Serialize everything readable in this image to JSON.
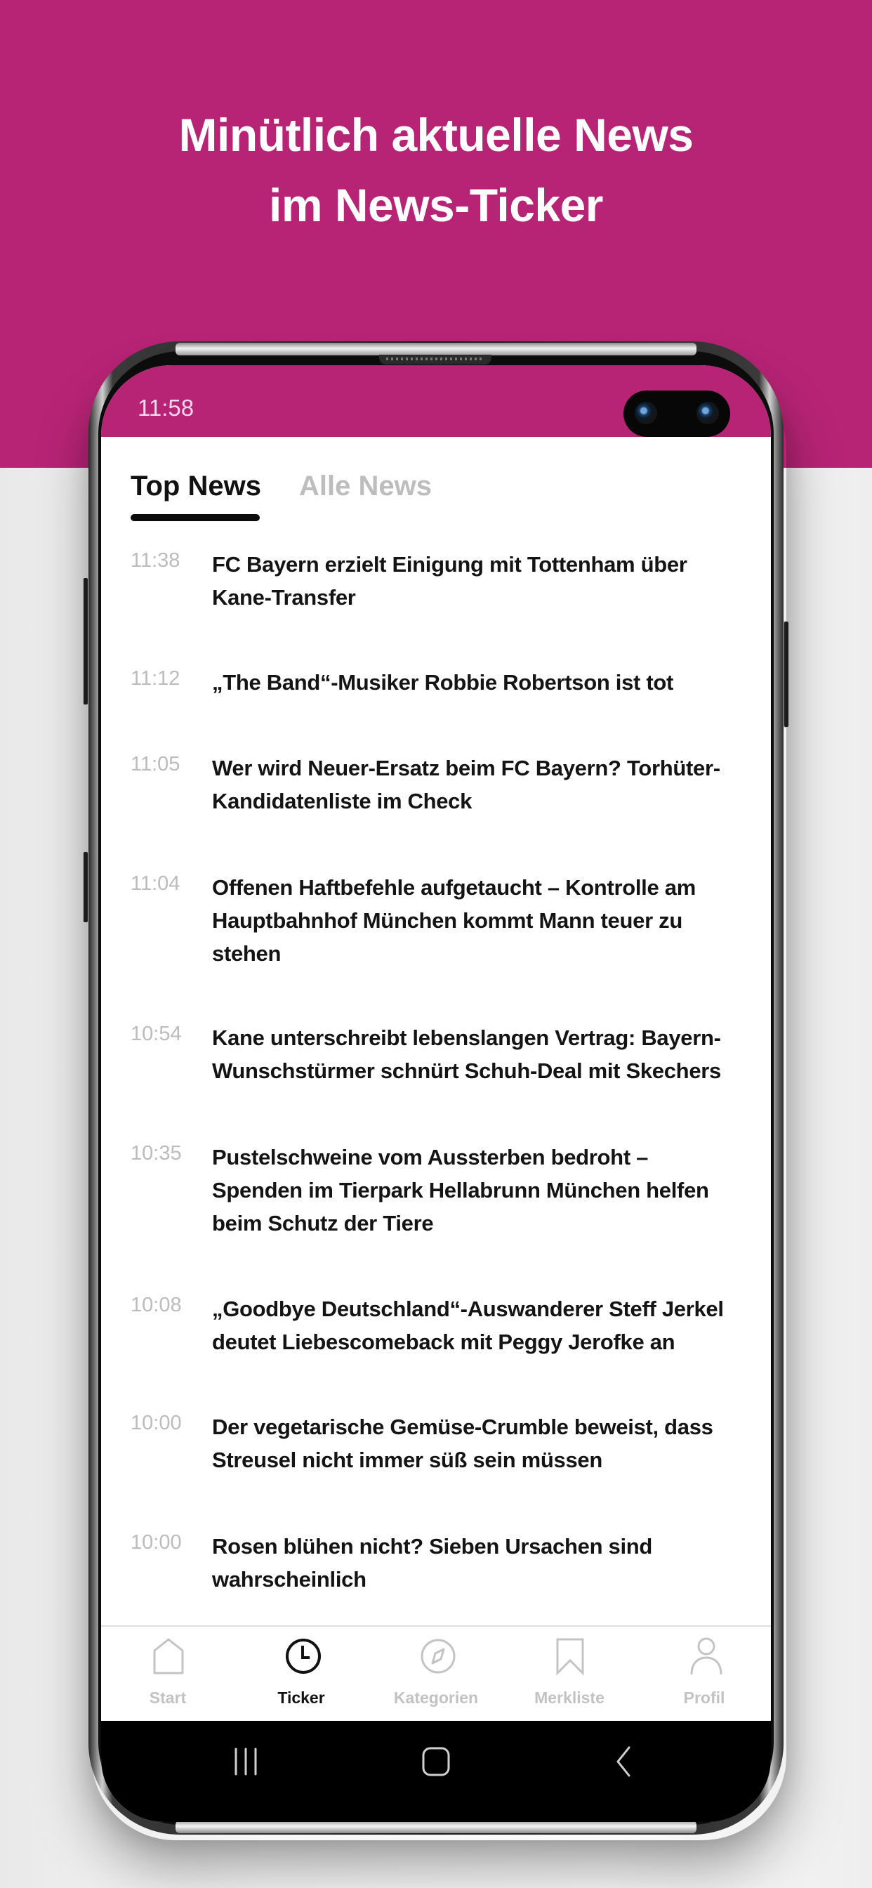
{
  "promo": {
    "headline_line1": "Minütlich aktuelle News",
    "headline_line2": "im News-Ticker",
    "brand_color": "#b72475"
  },
  "status_bar": {
    "time": "11:58"
  },
  "tabs": [
    {
      "label": "Top News",
      "active": true
    },
    {
      "label": "Alle News",
      "active": false
    }
  ],
  "news": [
    {
      "time": "11:38",
      "title": "FC Bayern erzielt Einigung mit Tottenham über Kane-Transfer"
    },
    {
      "time": "11:12",
      "title": "„The Band“-Musiker Robbie Robertson ist tot"
    },
    {
      "time": "11:05",
      "title": "Wer wird Neuer-Ersatz beim FC Bayern? Torhüter-Kandidatenliste im Check"
    },
    {
      "time": "11:04",
      "title": "Offenen Haftbefehle aufgetaucht – Kontrolle am Hauptbahnhof München kommt Mann teuer zu stehen"
    },
    {
      "time": "10:54",
      "title": "Kane unterschreibt lebenslangen Vertrag: Bayern-Wunschstürmer schnürt Schuh-Deal mit Skechers"
    },
    {
      "time": "10:35",
      "title": "Pustelschweine vom Aussterben bedroht – Spenden im Tierpark Hellabrunn München helfen beim Schutz der Tiere"
    },
    {
      "time": "10:08",
      "title": "„Goodbye Deutschland“-Auswanderer Steff Jerkel deutet Liebescomeback mit Peggy Jerofke an"
    },
    {
      "time": "10:00",
      "title": "Der vegetarische Gemüse-Crumble beweist, dass Streusel nicht immer süß sein müssen"
    },
    {
      "time": "10:00",
      "title": "Rosen blühen nicht? Sieben Ursachen sind wahrscheinlich"
    }
  ],
  "bottom_nav": [
    {
      "label": "Start",
      "icon": "home-icon",
      "active": false
    },
    {
      "label": "Ticker",
      "icon": "clock-icon",
      "active": true
    },
    {
      "label": "Kategorien",
      "icon": "compass-icon",
      "active": false
    },
    {
      "label": "Merkliste",
      "icon": "bookmark-icon",
      "active": false
    },
    {
      "label": "Profil",
      "icon": "person-icon",
      "active": false
    }
  ],
  "system_nav": [
    {
      "icon": "recent-apps-icon"
    },
    {
      "icon": "home-button-icon"
    },
    {
      "icon": "back-icon"
    }
  ]
}
